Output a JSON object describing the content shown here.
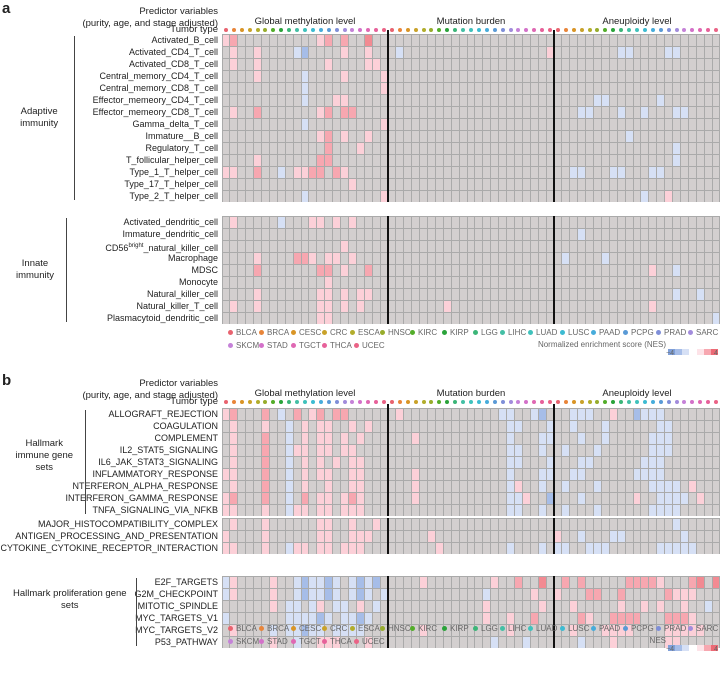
{
  "panels": [
    {
      "letter": "a",
      "header": {
        "line1": "Predictor variables",
        "line2": "(purity, age, and stage adjusted)",
        "tumor_type": "Tumor type"
      },
      "sections": [
        "Global methylation level",
        "Mutation burden",
        "Aneuploidy level"
      ],
      "blocks": [
        {
          "group": "Adaptive immunity",
          "rows": [
            "Activated_B_cell",
            "Activated_CD4_T_cell",
            "Activated_CD8_T_cell",
            "Central_memory_CD4_T_cell",
            "Central_memory_CD8_T_cell",
            "Effector_memeory_CD4_T_cell",
            "Effector_memeory_CD8_T_cell",
            "Gamma_delta_T_cell",
            "Immature__B_cell",
            "Regulatory_T_cell",
            "T_follicular_helper_cell",
            "Type_1_T_helper_cell",
            "Type_17_T_helper_cell",
            "Type_2_T_helper_cell"
          ],
          "matrix": [
            "120000000000120200300000000000000000000000000000000000000000000",
            "010010000-1-200001001000-1000000000000000000100000000-1-10000-1-100000",
            "010010000000010000110000000000000000000000000000000000000000000",
            "0000100000-1000010000100000000000000000000000000000000000000000",
            "0000000000-1000000000100000000000000000000000000000000000000000",
            "0000000000-1000110000000000000000000000000000000-1-1000000-1000",
            "010020000000120220000000000000000000000000000-1-1000-100-1000-1-1000",
            "0000000000-1000000000100000000000000000000000000000000000000000",
            "000000000000120100100000000000000000000000000000000-1000000000",
            "000000000000020001000000000000000000000000000000000000000-1000",
            "000010000000220000000000000000000000000000000000000000000-1000",
            "1100200-1011220210000000000000000000000000000-1-1000-1-1000-1-1000",
            "000000000000000010000000000000000000000000000000000000000000000",
            "0000000000-1000000000100000000000000000000000000000000-100100000"
          ]
        },
        {
          "group": "Innate immunity",
          "rows": [
            "Activated_dendritic_cell",
            "Immature_dendritic_cell",
            "CD56bright_natural_killer_cell",
            "Macrophage",
            "MDSC",
            "Monocyte",
            "Natural_killer_cell",
            "Natural_killer_T_cell",
            "Plasmacytoid_dendritic_cell"
          ],
          "matrix": [
            "0100000-10001101010000000000000000000000000000000000000000000000",
            "000000000000000000000000000000000000000000000-1000000000000000",
            "000000000000000100000000000000000000000000000000000000000000000",
            "0000100002210110100000000000000000000000000-10000-100000000000",
            "000020000000220100200000000000000000000000000000000000100-10000",
            "000000000000010000000000000000000000000000000000000000000000000",
            "000010000000110101100000000000000000000000000000000000000-100-10",
            "010010000000110101000000000010000000000000000000000000100000000",
            "00000000000011000000000000000000000000000000000000000000000000-1"
          ]
        }
      ],
      "legend": {
        "colorbar_label": "Normalized enrichment score (NES)",
        "min": "−4",
        "max": "4"
      }
    },
    {
      "letter": "b",
      "header": {
        "line1": "Predictor variables",
        "line2": "(purity, age, and stage adjusted)",
        "tumor_type": "Tumor type"
      },
      "sections": [
        "Global methylation level",
        "Mutation burden",
        "Aneuploidy level"
      ],
      "blocks": [
        {
          "group": "Hallmark immune gene sets",
          "rows": [
            "ALLOGRAFT_REJECTION",
            "COAGULATION",
            "COMPLEMENT",
            "IL2_STAT5_SIGNALING",
            "IL6_JAK_STAT3_SIGNALING",
            "INFLAMMATORY_RESPONSE",
            "NTERFERON_ALPHA_RESPONSE",
            "INTERFERON_GAMMA_RESPONSE",
            "TNFA_SIGNALING_VIA_NFKB"
          ],
          "matrix": [
            "1200020-1020120220000001000000000000-1-100-1-2000-1-1-100100-2-1-1-100",
            "01000100-1010110010100000000000000000-1-1000-100-1000-1000000-1-100",
            "01000200-1010110101000000100000000000-1000-1-1000-100-100000-1-1-100",
            "01000200-1110110110000000000000000000-1-100-100-1000-1000000-1-1-100",
            "01000200-1010101011000000000000000000-1-1000-1000-1-1000000-1-1-100",
            "11000200-1010110011000000100000000000-1000-1-100-1-1000000-1-1-1-100",
            "01000200-1010010011000000100000000000-1100-100-1000-1000000-1-1-1-101",
            "12000200-1020110121000000100000000000-1-1100-2000-1000000100-1-1-1-101",
            "11000100-1110110111000000000000000000-1-100-100-1000-1000000-1-1-1-100"
          ]
        },
        {
          "group": "",
          "rows": [
            "MAJOR_HISTOCOMPATIBILITY_COMPLEX",
            "ANTIGEN_PROCESSING_AND_PRESENTATION",
            "CYTOKINE_CYTOKINE_RECEPTOR_INTERACTION"
          ],
          "matrix": [
            "010001000000110010010000000000000000000000000000000000000-10000",
            "100001000000110011100000001000000000000000100-1000-1-10000000-1000",
            "11000100-1110110111000000000100000000-1000-10-1-100-1-1-1000000-1-1-1-1-1"
          ]
        },
        {
          "group": "Hallmark proliferation gene sets",
          "rows": [
            "E2F_TARGETS",
            "G2M_CHECKPOINT",
            "MITOTIC_SPINDLE",
            "MYC_TARGETS_V1",
            "MYC_TARGETS_V2",
            "P53_PATHWAY"
          ],
          "matrix": [
            "-110000100-1-2-1-1-2-10-1-2-1-20000010000000010020030020200000222210002303000011100",
            "-110000100-1-2-1-1-2-10-1-2-10-1000000000000-10000010010002200200000211100030300001000",
            "00000010-1-10-110-1-1010-100000000000001000000100010000010010100100-1000000-10",
            "-10000000-1-1-1-1-2-10-1-1-2-10000000000000010010020000021002222000222100",
            "010000-10-1-1-2-1-10-1-1-1-1000000010000000000100000001000111100001111100",
            "000000100-1001110001000000000000000-1000-1000000-1000100000011000000-100-1-1-1-1000"
          ]
        }
      ],
      "legend": {
        "colorbar_label": "NES",
        "min": "−4",
        "max": "4"
      }
    }
  ],
  "tumor_types": [
    {
      "name": "BLCA",
      "color": "#e8636f"
    },
    {
      "name": "BRCA",
      "color": "#e8853a"
    },
    {
      "name": "CESC",
      "color": "#d99526"
    },
    {
      "name": "CRC",
      "color": "#c9a22a"
    },
    {
      "name": "ESCA",
      "color": "#b2ad2c"
    },
    {
      "name": "HNSC",
      "color": "#97ac2c"
    },
    {
      "name": "KIRC",
      "color": "#53ad2a"
    },
    {
      "name": "KIRP",
      "color": "#2aa33a"
    },
    {
      "name": "LGG",
      "color": "#3bb578"
    },
    {
      "name": "LIHC",
      "color": "#44bfa5"
    },
    {
      "name": "LUAD",
      "color": "#3fc2bc"
    },
    {
      "name": "LUSC",
      "color": "#3dbbd2"
    },
    {
      "name": "PAAD",
      "color": "#47acdb"
    },
    {
      "name": "PCPG",
      "color": "#5a9ad6"
    },
    {
      "name": "PRAD",
      "color": "#7f8fd8"
    },
    {
      "name": "SARC",
      "color": "#a28cdc"
    },
    {
      "name": "SKCM",
      "color": "#c582d8"
    },
    {
      "name": "STAD",
      "color": "#d371c9"
    },
    {
      "name": "TGCT",
      "color": "#df68b3"
    },
    {
      "name": "THCA",
      "color": "#e7619a"
    },
    {
      "name": "UCEC",
      "color": "#ea6386"
    }
  ],
  "colors": {
    "neutral": "#d3cfcf",
    "pos1": "#fcd0d8",
    "pos2": "#f7a7b0",
    "pos3": "#f28a92",
    "neg1": "#d6e0f5",
    "neg2": "#a6bde8"
  },
  "chart_data": [
    {
      "type": "heatmap",
      "title": "a",
      "x_groups": [
        "Global methylation level",
        "Mutation burden",
        "Aneuploidy level"
      ],
      "x_categories_per_group": [
        "BLCA",
        "BRCA",
        "CESC",
        "CRC",
        "ESCA",
        "HNSC",
        "KIRC",
        "KIRP",
        "LGG",
        "LIHC",
        "LUAD",
        "LUSC",
        "PAAD",
        "PCPG",
        "PRAD",
        "SARC",
        "SKCM",
        "STAD",
        "TGCT",
        "THCA",
        "UCEC"
      ],
      "value_scale": "NES levels: -2 strong negative, -1 weak negative, 0 not significant, 1 weak positive, 2 moderate positive, 3 strong positive",
      "colorbar": {
        "label": "Normalized enrichment score (NES)",
        "range": [
          -4,
          4
        ]
      },
      "note": "Row values in panels[0].blocks[].matrix"
    },
    {
      "type": "heatmap",
      "title": "b",
      "x_groups": [
        "Global methylation level",
        "Mutation burden",
        "Aneuploidy level"
      ],
      "x_categories_per_group": [
        "BLCA",
        "BRCA",
        "CESC",
        "CRC",
        "ESCA",
        "HNSC",
        "KIRC",
        "KIRP",
        "LGG",
        "LIHC",
        "LUAD",
        "LUSC",
        "PAAD",
        "PCPG",
        "PRAD",
        "SARC",
        "SKCM",
        "STAD",
        "TGCT",
        "THCA",
        "UCEC"
      ],
      "colorbar": {
        "label": "NES",
        "range": [
          -4,
          4
        ]
      },
      "note": "Row values in panels[1].blocks[].matrix"
    }
  ]
}
